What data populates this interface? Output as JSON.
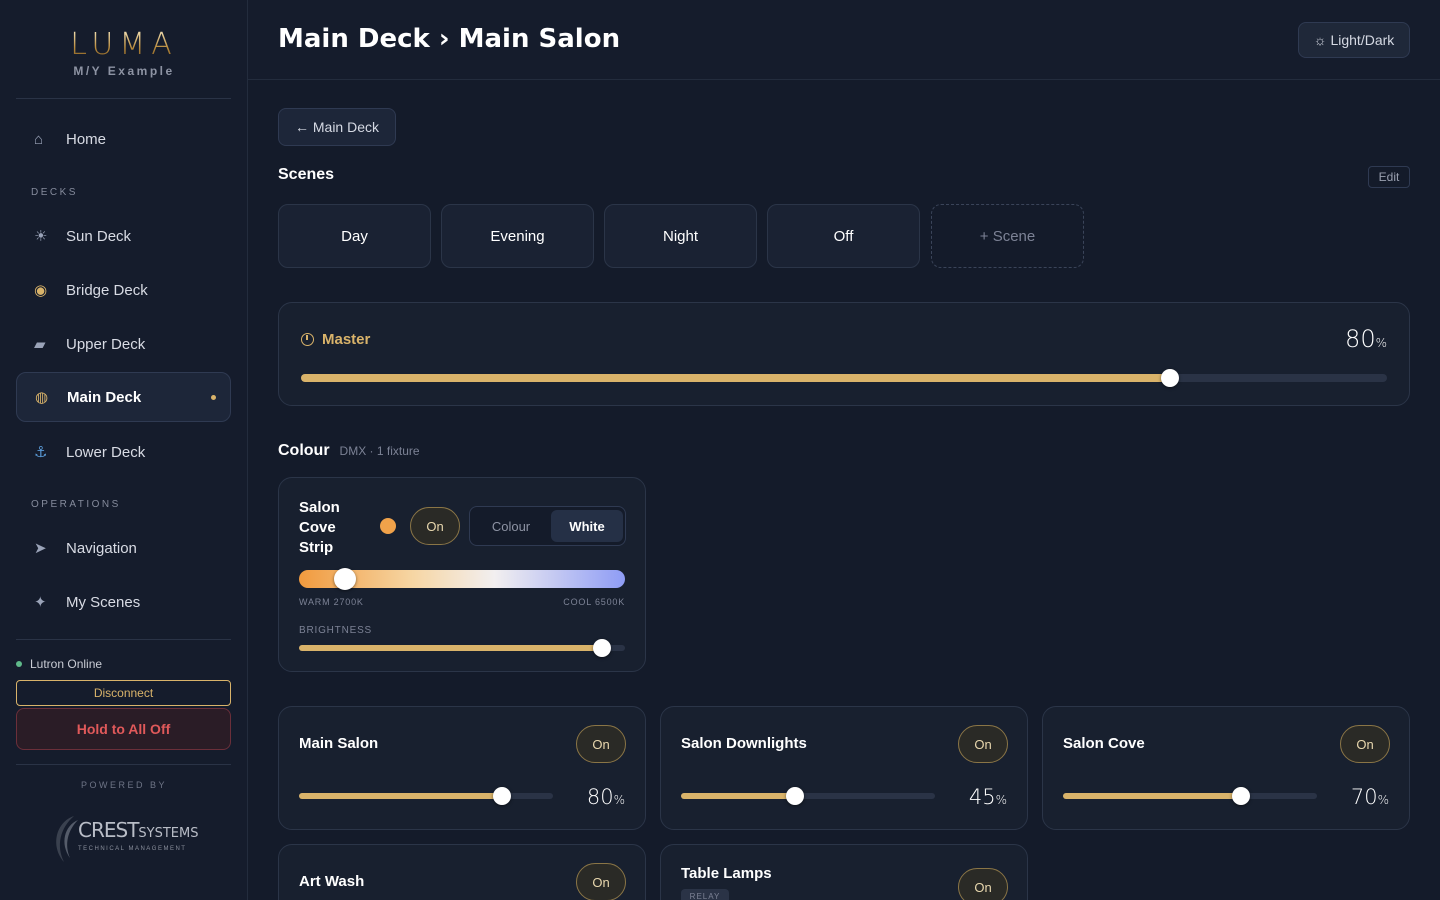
{
  "brand": {
    "logo": "LUMA",
    "vessel": "M/Y Example"
  },
  "sidebar": {
    "home": {
      "label": "Home",
      "icon": "home-icon"
    },
    "decks_heading": "DECKS",
    "decks": [
      {
        "label": "Sun Deck",
        "icon": "sun-icon"
      },
      {
        "label": "Bridge Deck",
        "icon": "compass-icon"
      },
      {
        "label": "Upper Deck",
        "icon": "boat-icon"
      },
      {
        "label": "Main Deck",
        "icon": "dining-icon",
        "active": true
      },
      {
        "label": "Lower Deck",
        "icon": "anchor-icon"
      }
    ],
    "operations_heading": "OPERATIONS",
    "operations": [
      {
        "label": "Navigation",
        "icon": "arrow-icon"
      },
      {
        "label": "My Scenes",
        "icon": "sparkle-icon"
      }
    ],
    "status": "Lutron Online",
    "disconnect_label": "Disconnect",
    "all_off_label": "Hold to All Off",
    "powered_by": "POWERED BY",
    "partner": {
      "name": "CREST",
      "suffix": "SYSTEMS",
      "tagline": "TECHNICAL MANAGEMENT"
    }
  },
  "header": {
    "title": "Main Deck › Main Salon",
    "theme_label": "☼ Light/Dark"
  },
  "back_label": "← Main Deck",
  "scenes": {
    "title": "Scenes",
    "edit_label": "Edit",
    "items": [
      "Day",
      "Evening",
      "Night",
      "Off"
    ],
    "add_label": "+ Scene"
  },
  "master": {
    "label": "Master",
    "value": 80,
    "unit": "%"
  },
  "colour": {
    "title": "Colour",
    "subtitle": "DMX · 1 fixture",
    "fixture": {
      "name_lines": [
        "Salon",
        "Cove",
        "Strip"
      ],
      "swatch_color": "#f0a24a",
      "on_label": "On",
      "modes": [
        "Colour",
        "White"
      ],
      "selected_mode": "White",
      "cct_position": 0.14,
      "warm_label": "WARM 2700K",
      "cool_label": "COOL 6500K",
      "brightness_label": "BRIGHTNESS",
      "brightness": 0.93
    }
  },
  "zones": [
    {
      "name": "Main Salon",
      "on_label": "On",
      "value": 80,
      "unit": "%"
    },
    {
      "name": "Salon Downlights",
      "on_label": "On",
      "value": 45,
      "unit": "%"
    },
    {
      "name": "Salon Cove",
      "on_label": "On",
      "value": 70,
      "unit": "%"
    },
    {
      "name": "Art Wash",
      "on_label": "On"
    },
    {
      "name": "Table Lamps",
      "on_label": "On",
      "tag": "RELAY"
    }
  ],
  "colors": {
    "accent": "#d9b36a",
    "danger": "#e0595a",
    "online": "#5fb98a",
    "background": "#141b2a"
  }
}
